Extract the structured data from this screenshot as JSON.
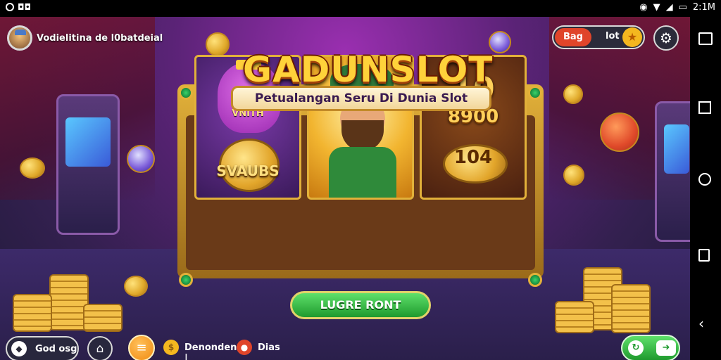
{
  "status_bar": {
    "time": "2:1M",
    "left_icons": [
      "circle-icon",
      "dots-icon"
    ],
    "right_icons": [
      "alarm-icon",
      "wifi-icon",
      "signal-icon",
      "battery-icon"
    ]
  },
  "profile": {
    "name": "Vodielitina de l0batdeial"
  },
  "top_right": {
    "balance_label": "Bag",
    "currency_label": "lot"
  },
  "game": {
    "title": "GADUNSLOT",
    "subtitle": "Petualangan Seru Di Dunia Slot",
    "reels": [
      {
        "top_text": "VNITH",
        "bottom_text": "SVAUBS"
      },
      {
        "name": "leprechaun"
      },
      {
        "top_text": "10",
        "middle_text": "8900",
        "bottom_text": "104"
      }
    ],
    "play_button": "LUGRE RONT"
  },
  "bottom_bar": {
    "left_pill": "God osg",
    "deposit_label": "Denonden |",
    "other_label": "Dias"
  },
  "colors": {
    "accent": "#ffd23a",
    "play_green": "#1f9a2e",
    "background": "#5b2377"
  }
}
